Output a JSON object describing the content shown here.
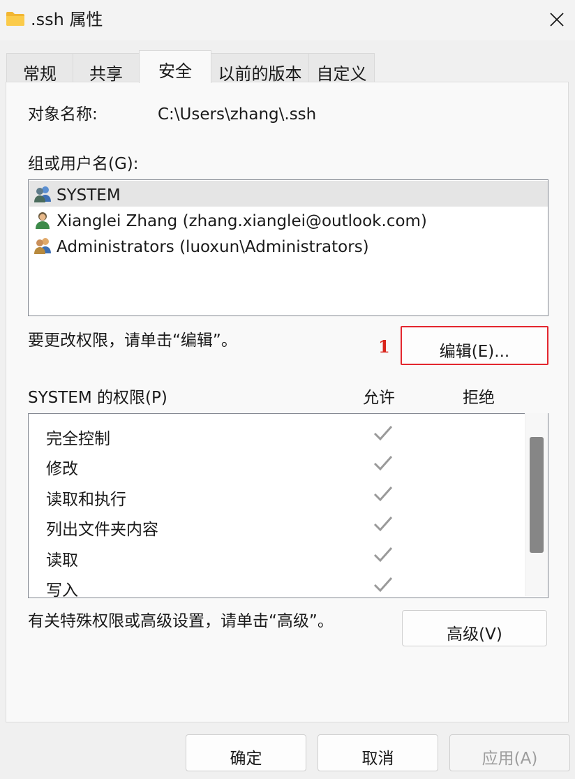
{
  "window": {
    "title": ".ssh 属性"
  },
  "tabs": [
    {
      "label": "常规"
    },
    {
      "label": "共享"
    },
    {
      "label": "安全",
      "active": true
    },
    {
      "label": "以前的版本"
    },
    {
      "label": "自定义"
    }
  ],
  "object_name": {
    "label": "对象名称:",
    "value": "C:\\Users\\zhang\\.ssh"
  },
  "groups": {
    "label": "组或用户名(G):",
    "items": [
      {
        "name": "SYSTEM",
        "icon": "group-users-icon",
        "selected": true
      },
      {
        "name": "Xianglei Zhang (zhang.xianglei@outlook.com)",
        "icon": "user-icon"
      },
      {
        "name": "Administrators (luoxun\\Administrators)",
        "icon": "group-users-icon"
      }
    ]
  },
  "edit_hint": "要更改权限，请单击“编辑”。",
  "annotation": {
    "number": "1",
    "color": "#d9251c"
  },
  "edit_button": {
    "label": "编辑(E)..."
  },
  "permissions": {
    "header": "SYSTEM 的权限(P)",
    "allow_label": "允许",
    "deny_label": "拒绝",
    "items": [
      {
        "name": "完全控制",
        "allow": true,
        "deny": false
      },
      {
        "name": "修改",
        "allow": true,
        "deny": false
      },
      {
        "name": "读取和执行",
        "allow": true,
        "deny": false
      },
      {
        "name": "列出文件夹内容",
        "allow": true,
        "deny": false
      },
      {
        "name": "读取",
        "allow": true,
        "deny": false
      },
      {
        "name": "写入",
        "allow": true,
        "deny": false
      }
    ]
  },
  "advanced_hint": "有关特殊权限或高级设置，请单击“高级”。",
  "advanced_button": {
    "label": "高级(V)"
  },
  "footer": {
    "ok": "确定",
    "cancel": "取消",
    "apply": "应用(A)"
  }
}
